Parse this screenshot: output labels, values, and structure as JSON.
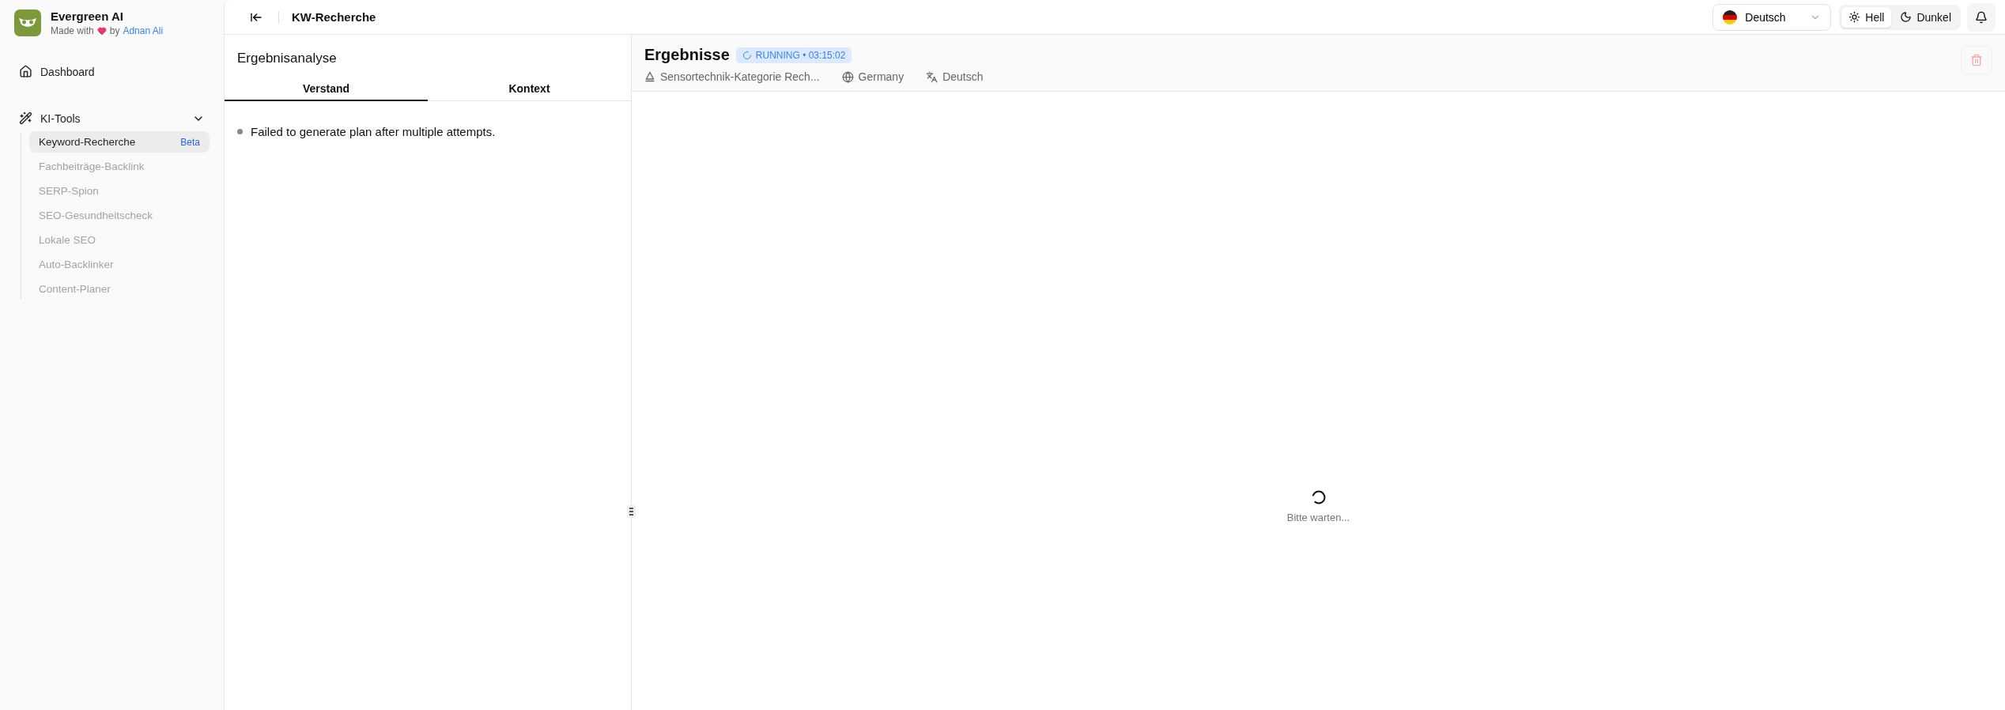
{
  "brand": {
    "name": "Evergreen AI",
    "tagline_prefix": "Made with",
    "tagline_by": "by",
    "author": "Adnan Ali"
  },
  "sidebar": {
    "items": [
      {
        "kind": "link",
        "label": "Dashboard",
        "selected": false
      },
      {
        "kind": "group",
        "label": "KI-Tools",
        "expanded": true,
        "children": [
          {
            "label": "Keyword-Recherche",
            "selected": true,
            "disabled": false,
            "badge": "Beta"
          },
          {
            "label": "Fachbeiträge-Backlink",
            "selected": false,
            "disabled": true
          },
          {
            "label": "SERP-Spion",
            "selected": false,
            "disabled": true
          },
          {
            "label": "SEO-Gesundheitscheck",
            "selected": false,
            "disabled": true
          },
          {
            "label": "Lokale SEO",
            "selected": false,
            "disabled": true
          },
          {
            "label": "Auto-Backlinker",
            "selected": false,
            "disabled": true
          },
          {
            "label": "Content-Planer",
            "selected": false,
            "disabled": true
          }
        ]
      }
    ]
  },
  "header": {
    "title": "KW-Recherche",
    "language": "Deutsch",
    "themes": [
      {
        "kind": "light",
        "label": "Hell",
        "selected": true
      },
      {
        "kind": "dark",
        "label": "Dunkel",
        "selected": false
      }
    ]
  },
  "analysis": {
    "title": "Ergebnisanalyse",
    "tabs": [
      {
        "label": "Verstand",
        "selected": true
      },
      {
        "label": "Kontext",
        "selected": false
      }
    ],
    "items": [
      "Failed to generate plan after multiple attempts."
    ]
  },
  "results": {
    "title": "Ergebnisse",
    "status": "RUNNING • 03:15:02",
    "meta": [
      {
        "kind": "topic",
        "text": "Sensortechnik-Kategorie Rech..."
      },
      {
        "kind": "country",
        "text": "Germany"
      },
      {
        "kind": "language",
        "text": "Deutsch"
      }
    ],
    "loading": "Bitte warten..."
  }
}
